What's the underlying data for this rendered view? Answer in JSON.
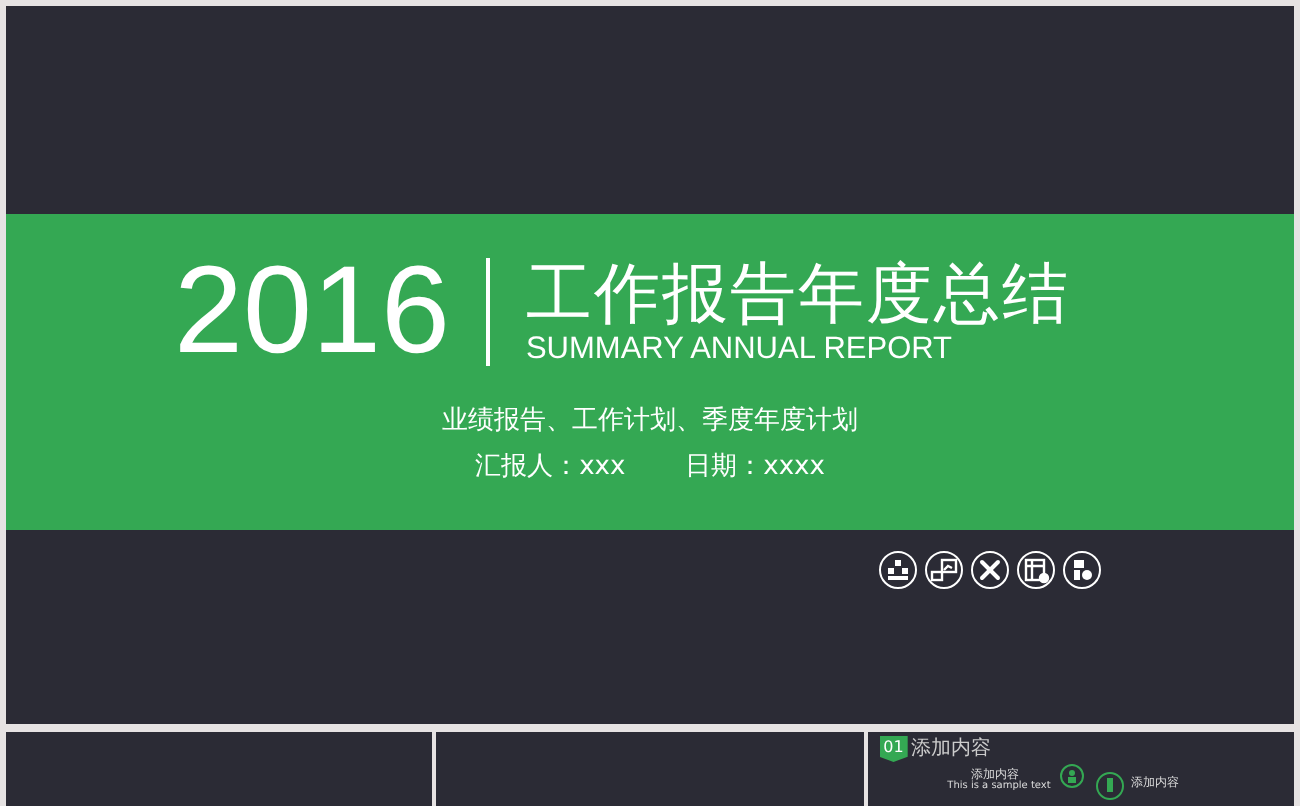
{
  "cover": {
    "year": "2016",
    "title": "工作报告年度总结",
    "subtitle": "SUMMARY ANNUAL REPORT",
    "tagline": "业绩报告、工作计划、季度年度计划",
    "reporter": "汇报人：xxx",
    "date": "日期：xxxx"
  },
  "thumbnails": [
    {
      "kind": "blank"
    },
    {
      "kind": "blank"
    },
    {
      "kind": "content",
      "badge": "01",
      "heading": "添加内容",
      "left_label": "添加内容",
      "left_text": "This is a sample text",
      "right_label": "添加内容"
    }
  ]
}
